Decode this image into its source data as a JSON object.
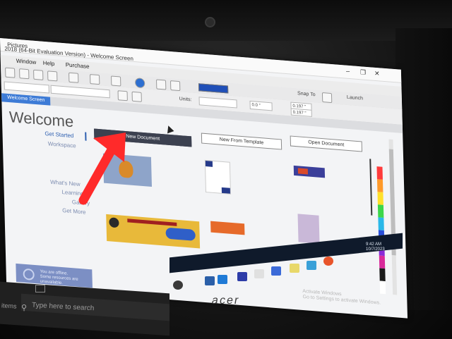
{
  "window": {
    "app_title": "Pictures",
    "title": "2018 (64-Bit Evaluation Version) - Welcome Screen"
  },
  "menu": [
    "Window",
    "Help",
    "Purchase"
  ],
  "toolbar": {
    "launch_label": "Launch",
    "snap_label": "Snap To",
    "units_label": "Units:"
  },
  "propbar": {
    "angle": "0.0 °",
    "nudge1": "0.197 \"",
    "nudge2": "0.197 \""
  },
  "tab": {
    "label": "Welcome Screen"
  },
  "welcome": {
    "heading": "Welcome",
    "sidebar": [
      "Get Started",
      "Workspace",
      "What's New",
      "Learning",
      "Gallery",
      "Get More"
    ],
    "buttons": {
      "new_document": "New Document",
      "new_from_template": "New From Template",
      "open_document": "Open Document"
    },
    "offline_msg": "You are offline.\nSome resources are\nunavailable."
  },
  "activate": {
    "line1": "Activate Windows",
    "line2": "Go to Settings to activate Windows."
  },
  "taskbar": {
    "search_placeholder": "Type here to search",
    "items_label": "items",
    "time": "9:42 AM",
    "date": "10/7/2023"
  },
  "bezel": {
    "brand": "acer"
  },
  "colors": {
    "accent_blue": "#3d7bd6",
    "primary_button": "#3c4150",
    "offline_panel": "#7c8fc4",
    "annotation_arrow": "#ff2a2a"
  }
}
